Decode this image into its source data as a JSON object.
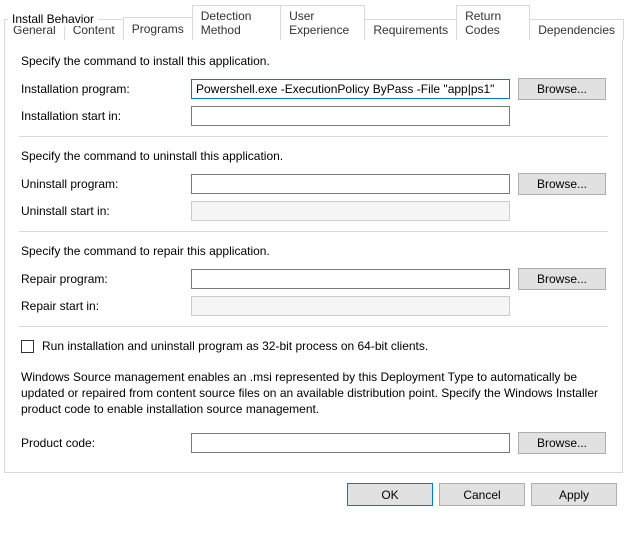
{
  "group_title": "Install Behavior",
  "tabs": {
    "general": "General",
    "content": "Content",
    "programs": "Programs",
    "detection": "Detection Method",
    "userexp": "User Experience",
    "requirements": "Requirements",
    "returncodes": "Return Codes",
    "dependencies": "Dependencies"
  },
  "install": {
    "heading": "Specify the command to install this application.",
    "program_label": "Installation program:",
    "program_value": "Powershell.exe -ExecutionPolicy ByPass -File \"app|ps1\"",
    "startin_label": "Installation start in:",
    "startin_value": ""
  },
  "uninstall": {
    "heading": "Specify the command to uninstall this application.",
    "program_label": "Uninstall program:",
    "program_value": "",
    "startin_label": "Uninstall start in:",
    "startin_value": ""
  },
  "repair": {
    "heading": "Specify the command to repair this application.",
    "program_label": "Repair program:",
    "program_value": "",
    "startin_label": "Repair start in:",
    "startin_value": ""
  },
  "checkbox32_label": "Run installation and uninstall program as 32-bit process on 64-bit clients.",
  "msi_info": "Windows Source management enables an .msi represented by this Deployment Type to automatically be updated or repaired from content source files on an available distribution point. Specify the Windows Installer product code to enable installation source management.",
  "product": {
    "label": "Product code:",
    "value": ""
  },
  "buttons": {
    "browse": "Browse...",
    "ok": "OK",
    "cancel": "Cancel",
    "apply": "Apply"
  }
}
